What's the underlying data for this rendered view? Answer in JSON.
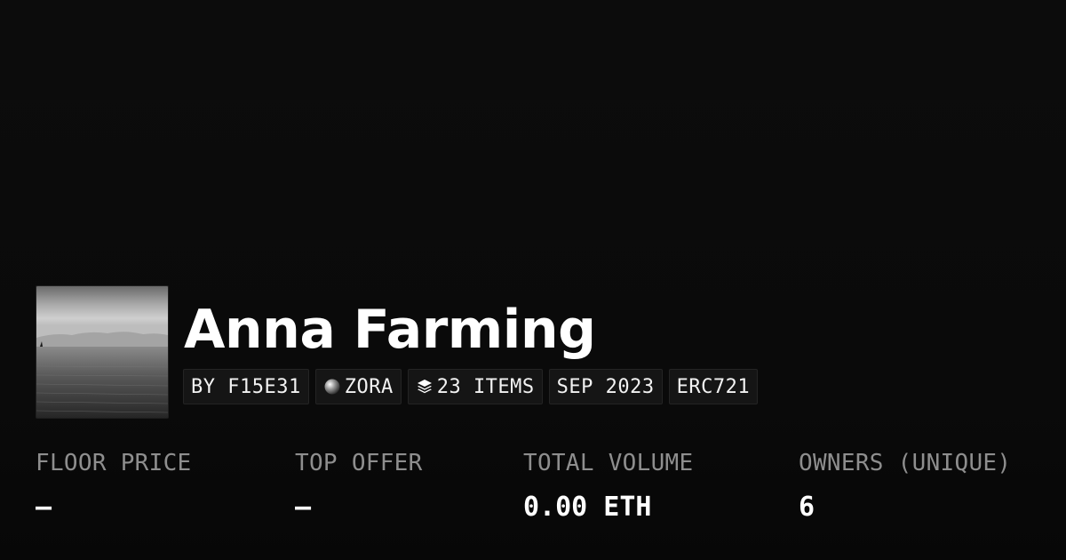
{
  "collection": {
    "name": "Anna Farming",
    "tags": {
      "creator": "BY F15E31",
      "network": "ZORA",
      "items": "23 ITEMS",
      "date": "SEP 2023",
      "standard": "ERC721"
    }
  },
  "stats": [
    {
      "label": "FLOOR PRICE",
      "value": "–"
    },
    {
      "label": "TOP OFFER",
      "value": "–"
    },
    {
      "label": "TOTAL VOLUME",
      "value": "0.00 ETH"
    },
    {
      "label": "OWNERS (UNIQUE)",
      "value": "6"
    }
  ],
  "icons": {
    "network": "zora-orb-icon",
    "items": "layers-icon"
  },
  "colors": {
    "background": "#0b0b0b",
    "tag_background": "#151515",
    "label_gray": "#8e8e8e",
    "text_white": "#ffffff"
  }
}
